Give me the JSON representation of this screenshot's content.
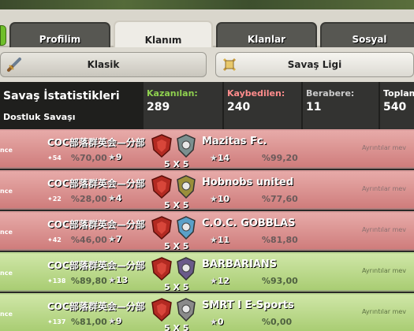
{
  "tabs": [
    {
      "label": "Profilim",
      "active": false
    },
    {
      "label": "Klanım",
      "active": true
    },
    {
      "label": "Klanlar",
      "active": false
    },
    {
      "label": "Sosyal",
      "active": false
    }
  ],
  "modes": [
    {
      "label": "Klasik",
      "icon": "sword-icon",
      "active": true
    },
    {
      "label": "Savaş Ligi",
      "icon": "crossed-swords-icon",
      "active": false
    }
  ],
  "stats": {
    "title": "Savaş İstatistikleri",
    "subtitle": "Dostluk Savaşı",
    "won_label": "Kazanılan:",
    "won": "289",
    "lost_label": "Kaybedilen:",
    "lost": "240",
    "draw_label": "Berabere:",
    "draw": "11",
    "total_label": "Toplam",
    "total": "540",
    "colors": {
      "won": "#8fd14f",
      "lost": "#ff8c8c",
      "draw": "#cccccc",
      "total": "#ffffff"
    }
  },
  "details_label": "Ayrıntılar mev",
  "edge_label": "nce",
  "rows": [
    {
      "result": "lose",
      "clan": "COC部落群英会—分部",
      "clan_level": "54",
      "pct": "%70,00",
      "stars": "9",
      "size": "5 X 5",
      "opponent": "Mazitas Fc.",
      "opp_stars": "14",
      "opp_pct": "%99,20"
    },
    {
      "result": "lose",
      "clan": "COC部落群英会—分部",
      "clan_level": "22",
      "pct": "%28,00",
      "stars": "4",
      "size": "5 X 5",
      "opponent": "Hobnobs united",
      "opp_stars": "10",
      "opp_pct": "%77,60"
    },
    {
      "result": "lose",
      "clan": "COC部落群英会—分部",
      "clan_level": "42",
      "pct": "%46,00",
      "stars": "7",
      "size": "5 X 5",
      "opponent": "C.O.C. GOBBLAS",
      "opp_stars": "11",
      "opp_pct": "%81,80"
    },
    {
      "result": "win",
      "clan": "COC部落群英会—分部",
      "clan_level": "138",
      "pct": "%89,80",
      "stars": "13",
      "size": "5 X 5",
      "opponent": "BARBARIANS",
      "opp_stars": "12",
      "opp_pct": "%93,00"
    },
    {
      "result": "win",
      "clan": "COC部落群英会—分部",
      "clan_level": "137",
      "pct": "%81,00",
      "stars": "9",
      "size": "5 X 5",
      "opponent": "SMRT I E-Sports",
      "opp_stars": "0",
      "opp_pct": "%0,00"
    }
  ]
}
